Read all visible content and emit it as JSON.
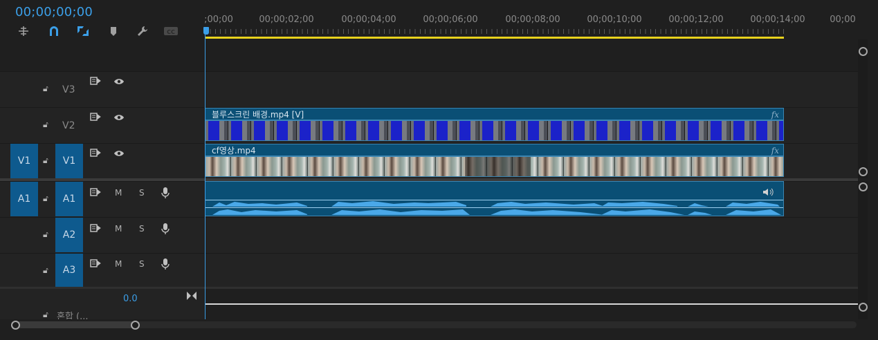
{
  "timecode": "00;00;00;00",
  "toolbar": {
    "tools": [
      {
        "name": "insert-overwrite-icon",
        "glyph": "⊹"
      },
      {
        "name": "snap-icon",
        "glyph": "∩"
      },
      {
        "name": "linked-selection-icon",
        "glyph": "⧉"
      },
      {
        "name": "add-marker-icon",
        "glyph": "⬟"
      },
      {
        "name": "wrench-icon",
        "glyph": "🔧"
      },
      {
        "name": "captions-icon",
        "glyph": "CC"
      }
    ]
  },
  "ruler": {
    "labels": [
      ";00;00",
      "00;00;02;00",
      "00;00;04;00",
      "00;00;06;00",
      "00;00;08;00",
      "00;00;10;00",
      "00;00;12;00",
      "00;00;14;00",
      "00;00"
    ]
  },
  "tracks": {
    "v3": {
      "label": "V3"
    },
    "v2": {
      "label": "V2"
    },
    "v1": {
      "source": "V1",
      "label": "V1"
    },
    "a1": {
      "source": "A1",
      "label": "A1",
      "m": "M",
      "s": "S"
    },
    "a2": {
      "label": "A2",
      "m": "M",
      "s": "S"
    },
    "a3": {
      "label": "A3",
      "m": "M",
      "s": "S"
    },
    "mix": {
      "label": "혼합 (...",
      "value": "0.0"
    }
  },
  "clips": {
    "v2_clip": {
      "name": "블루스크린 배경.mp4 [V]",
      "fx": "fx"
    },
    "v1_clip": {
      "name": "cf영상.mp4",
      "fx": "fx"
    }
  },
  "colors": {
    "accent": "#3b9fe8",
    "track_target": "#0e5a8e",
    "clip": "#0a4f75",
    "work_area": "#e8d21d"
  }
}
